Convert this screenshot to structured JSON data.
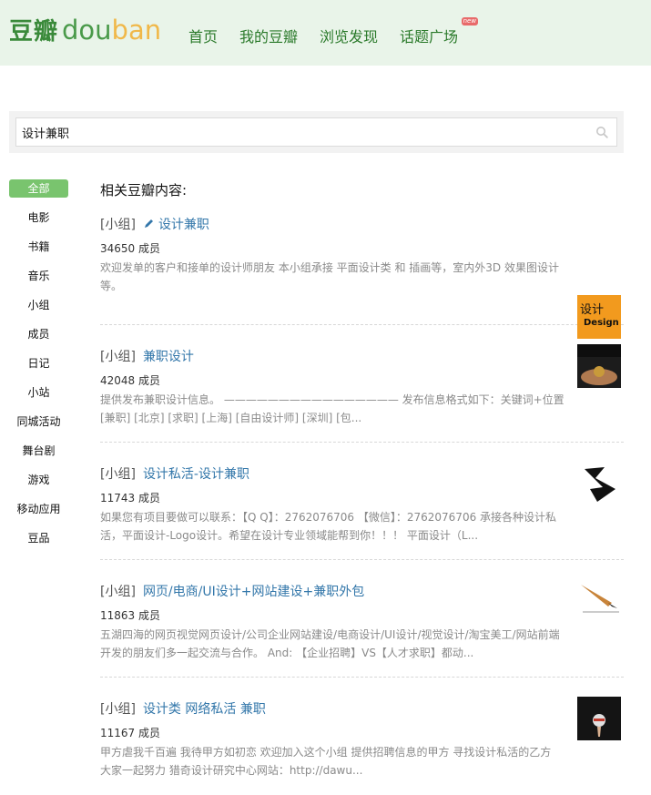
{
  "header": {
    "logo_cn": "豆瓣",
    "logo_en_a": "dou",
    "logo_en_b": "ban",
    "nav": [
      "首页",
      "我的豆瓣",
      "浏览发现",
      "话题广场"
    ],
    "new_badge": "new"
  },
  "search": {
    "value": "设计兼职"
  },
  "sidebar": {
    "items": [
      "全部",
      "电影",
      "书籍",
      "音乐",
      "小组",
      "成员",
      "日记",
      "小站",
      "同城活动",
      "舞台剧",
      "游戏",
      "移动应用",
      "豆品"
    ],
    "active": "全部"
  },
  "main": {
    "title": "相关豆瓣内容:",
    "results": [
      {
        "type": "[小组]",
        "name": "设计兼职",
        "members": "34650 成员",
        "desc": "欢迎发单的客户和接单的设计师朋友 本小组承接 平面设计类 和 插画等，室内外3D 效果图设计等。",
        "thumb_text_a": "设计",
        "thumb_text_b": "Design"
      },
      {
        "type": "[小组]",
        "name": "兼职设计",
        "members": "42048 成员",
        "desc": "提供发布兼职设计信息。 ———————————————— 发布信息格式如下：关键词+位置 [兼职] [北京] [求职] [上海] [自由设计师] [深圳] [包..."
      },
      {
        "type": "[小组]",
        "name": "设计私活-设计兼职",
        "members": "11743 成员",
        "desc": "如果您有项目要做可以联系：【Q Q】：2762076706 【微信】：2762076706 承接各种设计私活，平面设计-Logo设计。希望在设计专业领域能帮到你！！！ 平面设计（L..."
      },
      {
        "type": "[小组]",
        "name": "网页/电商/UI设计+网站建设+兼职外包",
        "members": "11863 成员",
        "desc": "五湖四海的网页视觉网页设计/公司企业网站建设/电商设计/UI设计/视觉设计/淘宝美工/网站前端开发的朋友们多一起交流与合作。 And: 【企业招聘】VS【人才求职】都动..."
      },
      {
        "type": "[小组]",
        "name": "设计类 网络私活 兼职",
        "members": "11167 成员",
        "desc": "甲方虐我千百遍 我待甲方如初恋 欢迎加入这个小组 提供招聘信息的甲方 寻找设计私活的乙方 大家一起努力 猎奇设计研究中心网站：http://dawu..."
      }
    ]
  },
  "colors": {
    "brand_green": "#3a8a3a",
    "link": "#3377aa",
    "active_tab": "#79c46e",
    "header_bg": "#e9f4e9"
  }
}
